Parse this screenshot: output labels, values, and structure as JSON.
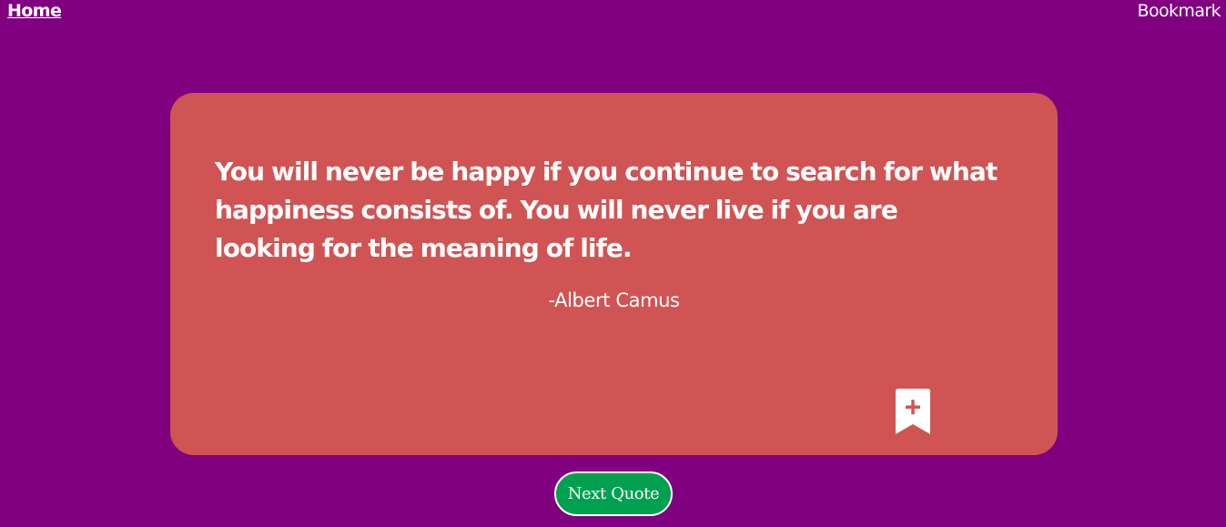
{
  "nav": {
    "home_label": "Home",
    "bookmark_label": "Bookmark"
  },
  "quote": {
    "text": "You will never be happy if you continue to search for what happiness consists of. You will never live if you are looking for the meaning of life.",
    "author": "-Albert Camus"
  },
  "actions": {
    "add_bookmark_icon": "bookmark-plus-icon",
    "next_label": "Next Quote"
  },
  "colors": {
    "background": "#800080",
    "card": "#cf5453",
    "next_button": "#00a050",
    "text": "#ffffff"
  }
}
